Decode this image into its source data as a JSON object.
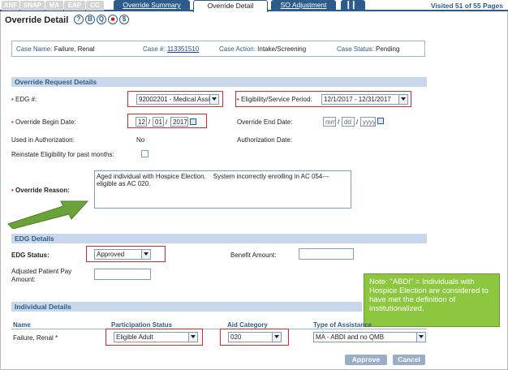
{
  "tabs": {
    "gray": [
      "ANF",
      "SNAP",
      "MA",
      "EAP",
      "CC"
    ],
    "override_summary": "Override Summary",
    "override_detail": "Override Detail",
    "so_adjustment": "SO Adjustment",
    "pause_icon": "▎▎",
    "visited": "Visited 51 of 55 Pages"
  },
  "page": {
    "title": "Override Detail",
    "icons": [
      "?",
      "B",
      "Q",
      "■",
      "$"
    ]
  },
  "case": {
    "name_label": "Case Name:",
    "name_value": "Failure, Renal",
    "num_label": "Case #:",
    "num_value": "113351510",
    "action_label": "Case Action:",
    "action_value": "Intake/Screening",
    "status_label": "Case Status:",
    "status_value": "Pending"
  },
  "override_request": {
    "section": "Override Request Details",
    "edg_label": "EDG #:",
    "edg_value": "92002201 - Medical Assis",
    "period_label": "Eligibility/Service Period:",
    "period_value": "12/1/2017 - 12/31/2017",
    "begin_label": "Override Begin Date:",
    "begin_mm": "12",
    "begin_dd": "01",
    "begin_yyyy": "2017",
    "end_label": "Override End Date:",
    "end_mm": "mm",
    "end_dd": "dd",
    "end_yyyy": "yyyy",
    "used_label": "Used in Authorization:",
    "used_value": "No",
    "auth_label": "Authorization Date:",
    "reinstate_label": "Reinstate Eligibility for past months:",
    "reason_label": "Override Reason:",
    "reason_value": "Aged individual with Hospice Election.    System incorrectly enrolling in AC 054---eligible as AC 020."
  },
  "edg_details": {
    "section": "EDG Details",
    "status_label": "EDG Status:",
    "status_value": "Approved",
    "benefit_label": "Benefit Amount:",
    "patient_pay_label": "Adjusted Patient Pay Amount:"
  },
  "individual": {
    "section": "Individual Details",
    "headers": [
      "Name",
      "Participation Status",
      "Aid Category",
      "Type of Assistance"
    ],
    "row": {
      "name": "Failure, Renal *",
      "participation": "Eligible Adult",
      "aid": "020",
      "type": "MA - ABDI and no QMB"
    }
  },
  "note": "Note:  \"ABDI\" = Individuals with Hospice Election are considered to have met the definition of  institutionalized.",
  "buttons": {
    "approve": "Approve",
    "cancel": "Cancel"
  },
  "colors": {
    "accent": "#2e5c8a",
    "highlight": "#e02a2a",
    "note": "#8dc63f"
  }
}
